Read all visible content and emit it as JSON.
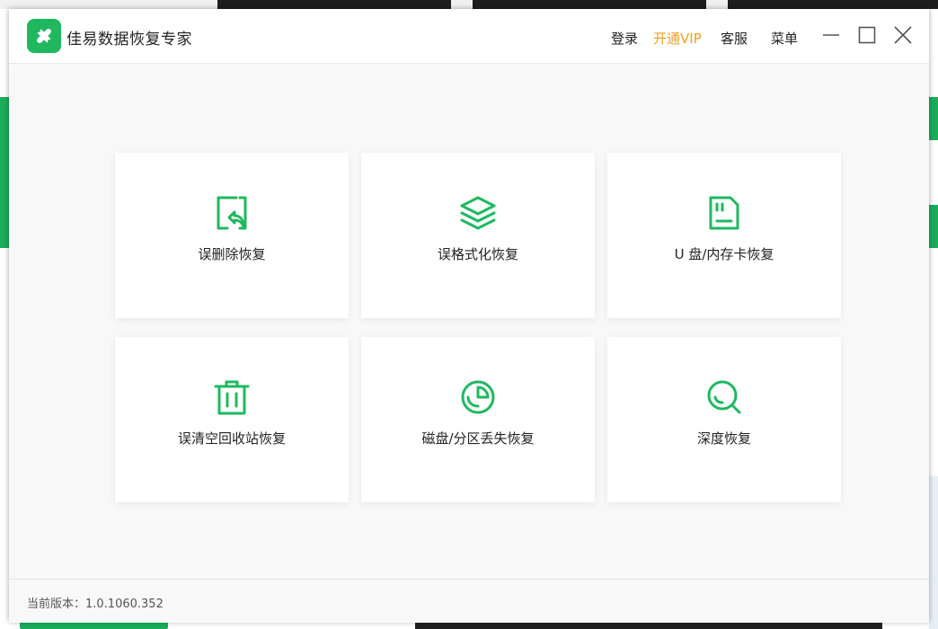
{
  "app": {
    "title": "佳易数据恢复专家",
    "accent_color": "#1fb85f"
  },
  "header": {
    "login_label": "登录",
    "vip_label": "开通VIP",
    "service_label": "客服",
    "menu_label": "菜单"
  },
  "cards": [
    {
      "label": "误删除恢复",
      "icon": "file-restore-icon"
    },
    {
      "label": "误格式化恢复",
      "icon": "layers-icon"
    },
    {
      "label": "U 盘/内存卡恢复",
      "icon": "sd-card-icon"
    },
    {
      "label": "误清空回收站恢复",
      "icon": "trash-icon"
    },
    {
      "label": "磁盘/分区丢失恢复",
      "icon": "pie-chart-icon"
    },
    {
      "label": "深度恢复",
      "icon": "deep-search-icon"
    }
  ],
  "footer": {
    "version_text": "当前版本：1.0.1060.352"
  }
}
